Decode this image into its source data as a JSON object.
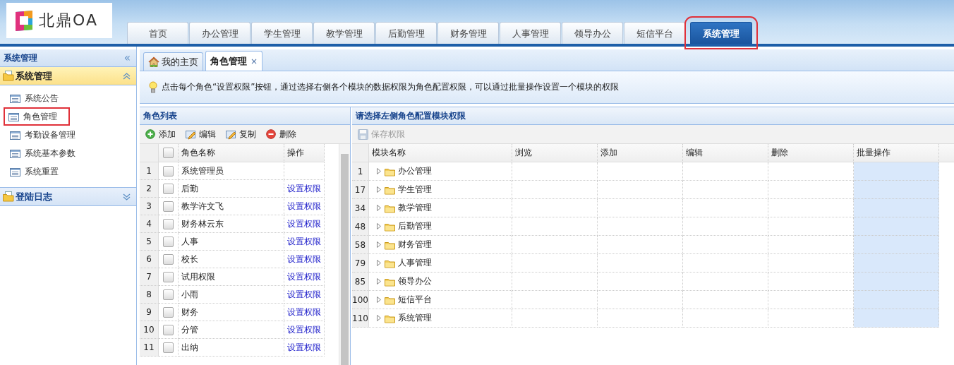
{
  "logo": {
    "text": "北鼎OA"
  },
  "nav_tabs": [
    {
      "label": "首页",
      "selected": false,
      "highlighted": false
    },
    {
      "label": "办公管理",
      "selected": false,
      "highlighted": false
    },
    {
      "label": "学生管理",
      "selected": false,
      "highlighted": false
    },
    {
      "label": "教学管理",
      "selected": false,
      "highlighted": false
    },
    {
      "label": "后勤管理",
      "selected": false,
      "highlighted": false
    },
    {
      "label": "财务管理",
      "selected": false,
      "highlighted": false
    },
    {
      "label": "人事管理",
      "selected": false,
      "highlighted": false
    },
    {
      "label": "领导办公",
      "selected": false,
      "highlighted": false
    },
    {
      "label": "短信平台",
      "selected": false,
      "highlighted": false
    },
    {
      "label": "系统管理",
      "selected": true,
      "highlighted": true
    }
  ],
  "sidebar": {
    "title": "系统管理",
    "collapse_label": "«",
    "sections": [
      {
        "title": "系统管理",
        "expanded": true,
        "items": [
          {
            "label": "系统公告",
            "highlighted": false
          },
          {
            "label": "角色管理",
            "highlighted": true
          },
          {
            "label": "考勤设备管理",
            "highlighted": false
          },
          {
            "label": "系统基本参数",
            "highlighted": false
          },
          {
            "label": "系统重置",
            "highlighted": false
          }
        ]
      },
      {
        "title": "登陆日志",
        "expanded": false
      }
    ]
  },
  "page_tabs": [
    {
      "label": "我的主页",
      "kind": "home",
      "selected": false
    },
    {
      "label": "角色管理",
      "kind": "closable",
      "selected": true,
      "close_label": "×"
    }
  ],
  "notice": "点击每个角色“设置权限”按钮，通过选择右侧各个模块的数据权限为角色配置权限，可以通过批量操作设置一个模块的权限",
  "role_list": {
    "title": "角色列表",
    "toolbar": [
      {
        "label": "添加",
        "kind": "add"
      },
      {
        "label": "编辑",
        "kind": "edit"
      },
      {
        "label": "复制",
        "kind": "copy"
      },
      {
        "label": "删除",
        "kind": "delete"
      }
    ],
    "header_checked": false,
    "columns": [
      "角色名称",
      "操作"
    ],
    "rows": [
      {
        "index": "1",
        "name": "系统管理员",
        "checked": false
      },
      {
        "index": "2",
        "name": "后勤",
        "action": "设置权限",
        "checked": false
      },
      {
        "index": "3",
        "name": "教学许文飞",
        "action": "设置权限",
        "checked": false
      },
      {
        "index": "4",
        "name": "财务林云东",
        "action": "设置权限",
        "checked": false
      },
      {
        "index": "5",
        "name": "人事",
        "action": "设置权限",
        "checked": false
      },
      {
        "index": "6",
        "name": "校长",
        "action": "设置权限",
        "checked": false
      },
      {
        "index": "7",
        "name": "试用权限",
        "action": "设置权限",
        "checked": false
      },
      {
        "index": "8",
        "name": "小雨",
        "action": "设置权限",
        "checked": false
      },
      {
        "index": "9",
        "name": "财务",
        "action": "设置权限",
        "checked": false
      },
      {
        "index": "10",
        "name": "分管",
        "action": "设置权限",
        "checked": false
      },
      {
        "index": "11",
        "name": "出纳",
        "action": "设置权限",
        "checked": false
      }
    ]
  },
  "permissions": {
    "title": "请选择左侧角色配置模块权限",
    "toolbar": [
      {
        "label": "保存权限",
        "disabled": true
      }
    ],
    "columns": [
      "模块名称",
      "浏览",
      "添加",
      "编辑",
      "删除",
      "批量操作"
    ],
    "rows": [
      {
        "index": "1",
        "name": "办公管理",
        "expanded": false
      },
      {
        "index": "17",
        "name": "学生管理",
        "expanded": false
      },
      {
        "index": "34",
        "name": "教学管理",
        "expanded": false
      },
      {
        "index": "48",
        "name": "后勤管理",
        "expanded": false
      },
      {
        "index": "58",
        "name": "财务管理",
        "expanded": false
      },
      {
        "index": "79",
        "name": "人事管理",
        "expanded": false
      },
      {
        "index": "85",
        "name": "领导办公",
        "expanded": false
      },
      {
        "index": "100",
        "name": "短信平台",
        "expanded": false
      },
      {
        "index": "110",
        "name": "系统管理",
        "expanded": false
      }
    ]
  }
}
